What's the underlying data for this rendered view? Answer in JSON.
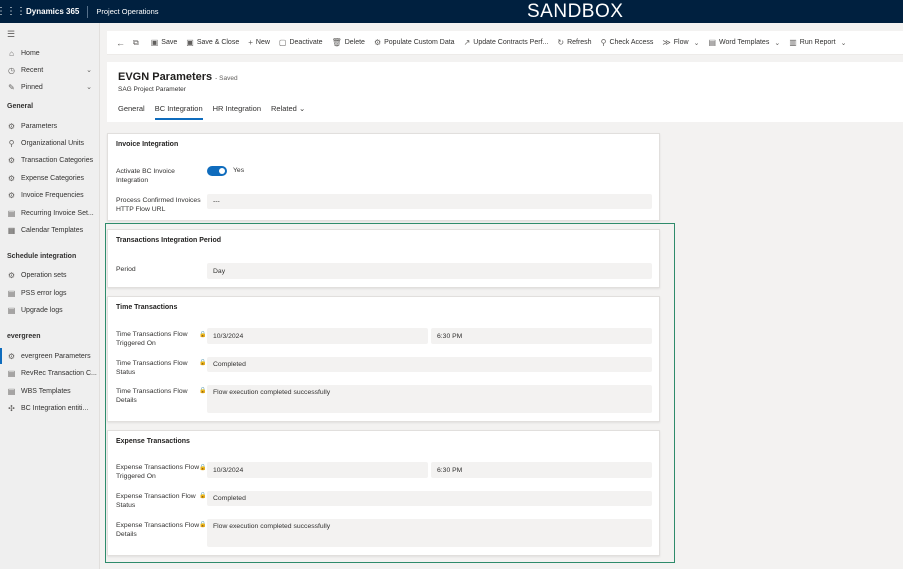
{
  "topbar": {
    "app": "Dynamics 365",
    "module": "Project Operations",
    "environment": "SANDBOX"
  },
  "sidebar": {
    "top_items": [
      {
        "label": "Home",
        "icon": "home-icon"
      },
      {
        "label": "Recent",
        "icon": "clock-icon"
      },
      {
        "label": "Pinned",
        "icon": "pin-icon"
      }
    ],
    "groups": [
      {
        "title": "General",
        "items": [
          "Parameters",
          "Organizational Units",
          "Transaction Categories",
          "Expense Categories",
          "Invoice Frequencies",
          "Recurring Invoice Set...",
          "Calendar Templates"
        ]
      },
      {
        "title": "Schedule integration",
        "items": [
          "Operation sets",
          "PSS error logs",
          "Upgrade logs"
        ]
      },
      {
        "title": "evergreen",
        "items": [
          "evergreen Parameters",
          "RevRec Transaction C...",
          "WBS Templates",
          "BC Integration entiti..."
        ]
      }
    ]
  },
  "commands": [
    "Save",
    "Save & Close",
    "New",
    "Deactivate",
    "Delete",
    "Populate Custom Data",
    "Update Contracts Perf...",
    "Refresh",
    "Check Access",
    "Flow",
    "Word Templates",
    "Run Report"
  ],
  "header": {
    "title": "EVGN Parameters",
    "saved": "- Saved",
    "subtitle": "SAG Project Parameter",
    "tabs": [
      "General",
      "BC Integration",
      "HR Integration",
      "Related"
    ]
  },
  "invoice": {
    "title": "Invoice Integration",
    "activate_label": "Activate BC Invoice Integration",
    "activate_value": "Yes",
    "url_label": "Process Confirmed Invoices HTTP Flow URL",
    "url_value": "---"
  },
  "period": {
    "title": "Transactions Integration Period",
    "label": "Period",
    "value": "Day"
  },
  "time": {
    "title": "Time Transactions",
    "triggered_label": "Time Transactions Flow Triggered On",
    "date": "10/3/2024",
    "time": "6:30 PM",
    "status_label": "Time Transactions Flow Status",
    "status": "Completed",
    "details_label": "Time Transactions Flow Details",
    "details": "Flow execution completed successfully"
  },
  "expense": {
    "title": "Expense Transactions",
    "triggered_label": "Expense Transactions Flow Triggered On",
    "date": "10/3/2024",
    "time": "6:30 PM",
    "status_label": "Expense Transaction Flow Status",
    "status": "Completed",
    "details_label": "Expense Transactions Flow Details",
    "details": "Flow execution completed successfully"
  },
  "colors": {
    "topbar": "#00203f",
    "accent": "#0f6cbd",
    "highlight": "#2e8b6b"
  }
}
